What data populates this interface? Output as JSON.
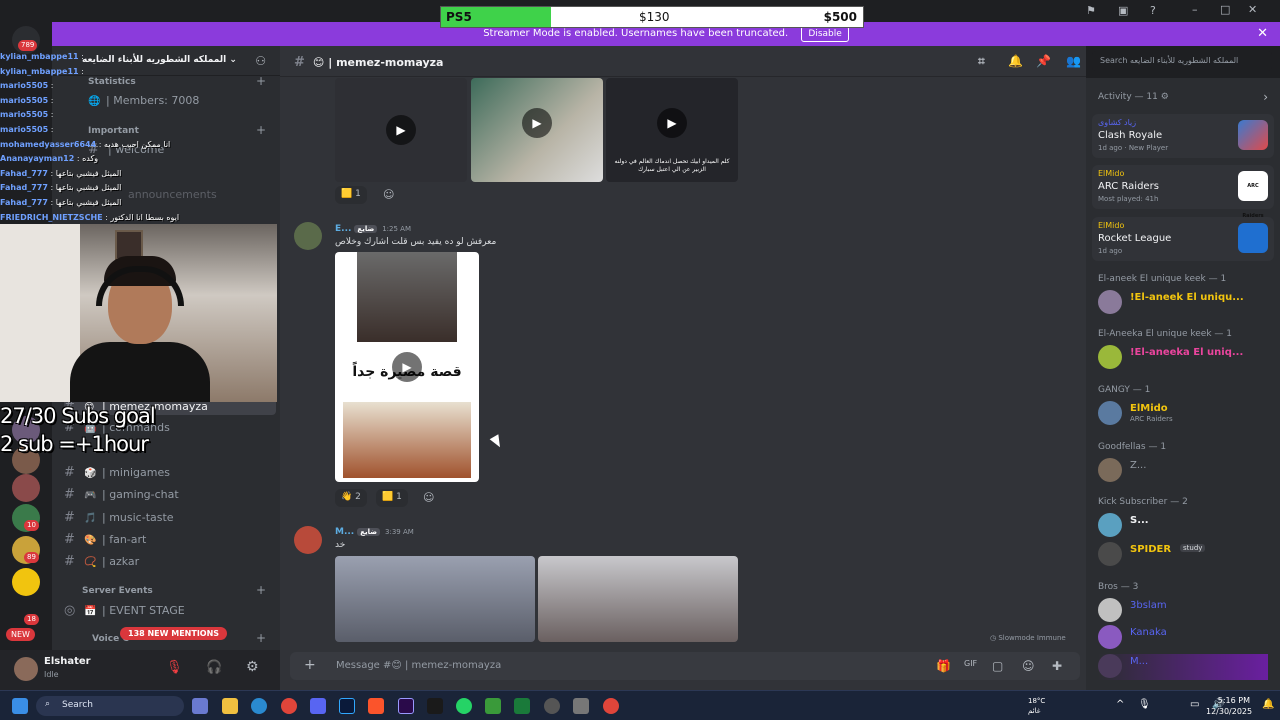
{
  "goal_bar": {
    "label": "PS5",
    "mid_value": "$130",
    "max_value": "$500",
    "progress_fraction": 0.26
  },
  "banner": {
    "text": "Streamer Mode is enabled. Usernames have been truncated.",
    "disable_label": "Disable"
  },
  "server": {
    "name": "المملكه الشطوريه للأبناء الضايعه"
  },
  "server_badge": "789",
  "channel_sidebar": {
    "statistics_label": "Statistics",
    "members_label": "| Members: 7008",
    "important_label": "Important",
    "welcome_label": "| welcome",
    "announcements_label": "announcements",
    "active_channel": "| memez-momayza",
    "commands_label": "| commands",
    "minigames_label": "| minigames",
    "gaming_chat_label": "| gaming-chat",
    "music_taste_label": "| music-taste",
    "fan_art_label": "| fan-art",
    "azkar_label": "| azkar",
    "server_events_label": "Server Events",
    "event_stage_label": "| EVENT STAGE",
    "voice_label": "Voice C",
    "mentions_label": "138 NEW MENTIONS"
  },
  "server_badges": [
    "10",
    "89",
    "18"
  ],
  "new_label": "NEW",
  "stream_chat": [
    {
      "name": "kylian_mbappe11",
      "msg": ""
    },
    {
      "name": "kylian_mbappe11",
      "msg": ""
    },
    {
      "name": "mario5505",
      "msg": ""
    },
    {
      "name": "mario5505",
      "msg": ""
    },
    {
      "name": "mario5505",
      "msg": ""
    },
    {
      "name": "mario5505",
      "msg": ""
    },
    {
      "name": "mohamedyasser6644",
      "msg": "انا ممكن اجيب هديه"
    },
    {
      "name": "Ananayayman12",
      "msg": "وكده"
    },
    {
      "name": "Fahad_777",
      "msg": "الميثل فيشبي بتاعها"
    },
    {
      "name": "Fahad_777",
      "msg": "الميثل فيشبي بتاعها"
    },
    {
      "name": "Fahad_777",
      "msg": "الميثل فيشبي بتاعها"
    },
    {
      "name": "FRIEDRICH_NIETZSCHE",
      "msg": "ايوه بسطا انا الدكتور"
    }
  ],
  "stream_goal": {
    "line1": "27/30 Subs goal",
    "line2": "2 sub =+1hour"
  },
  "user": {
    "name": "Elshater",
    "status": "Idle"
  },
  "chat": {
    "channel_title": "| memez-momayza",
    "search_placeholder": "Search المملكه الشطوريه للأبناء الضايعه",
    "message1": {
      "author": "E...",
      "tag": "ضايع",
      "time": "1:25 AM",
      "text": "معرفش لو ده يفيد بس قلت اشارك وخلاص",
      "overlay_text": "قصة مصيرة جداً"
    },
    "reactions_top": [
      {
        "count": "1"
      }
    ],
    "reactions_mid": [
      {
        "count": "2"
      },
      {
        "count": "1"
      }
    ],
    "message2": {
      "author": "M...",
      "tag": "ضايع",
      "time": "3:39 AM",
      "text": "خد"
    },
    "video_caption": "كلم الميداو ابيك تحصل اندماك العالم في دولنه الزبير عن الي اعتبل سبارك",
    "slowmode_label": "Slowmode Immune",
    "composer_placeholder": "Message #😊 | memez-momayza"
  },
  "activity": {
    "header": "Activity — 11",
    "cards": [
      {
        "title": "زياد كشاوى",
        "game": "Clash Royale",
        "sub": "1d ago  ·  New Player"
      },
      {
        "title": "ElMido",
        "game": "ARC Raiders",
        "sub": "Most played: 41h"
      },
      {
        "title": "ElMido",
        "game": "Rocket League",
        "sub": "1d ago"
      }
    ],
    "arc_logo_text": "ARC Raiders"
  },
  "members": {
    "sections": [
      {
        "label": "El-aneek El unique keek — 1",
        "name": "!El-aneek El uniqu...",
        "status": ""
      },
      {
        "label": "El-Aneeka El unique keek — 1",
        "name": "!El-aneeka El uniq...",
        "status": ""
      },
      {
        "label": "GANGY — 1",
        "name": "ElMido",
        "status": "ARC Raiders"
      },
      {
        "label": "Goodfellas — 1",
        "name": "Z...",
        "status": ""
      },
      {
        "label": "Kick Subscriber — 2",
        "name": "S...",
        "status": ""
      },
      {
        "label": "",
        "name": "SPIDER",
        "status": "study"
      },
      {
        "label": "Bros — 3",
        "name": "3bslam",
        "status": ""
      },
      {
        "label": "",
        "name": "Kanaka",
        "status": ""
      },
      {
        "label": "",
        "name": "M...",
        "status": ""
      }
    ]
  },
  "taskbar": {
    "search_label": "Search",
    "weather_temp": "18°C",
    "weather_desc": "غائم",
    "time": "5:16 PM",
    "date": "12/30/2025"
  },
  "colors": {
    "accent": "#5865f2",
    "banner": "#8b3bdc",
    "goal_fill": "#3fd24a"
  }
}
